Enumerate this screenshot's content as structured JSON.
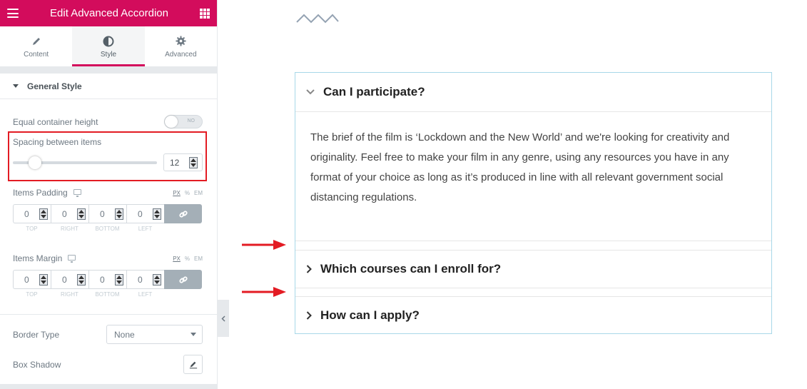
{
  "header": {
    "title": "Edit Advanced Accordion",
    "menu_icon": "hamburger-icon",
    "apps_icon": "grid-icon"
  },
  "tabs": [
    {
      "label": "Content",
      "icon": "pencil-icon",
      "active": false
    },
    {
      "label": "Style",
      "icon": "contrast-icon",
      "active": true
    },
    {
      "label": "Advanced",
      "icon": "gear-icon",
      "active": false
    }
  ],
  "section": {
    "title": "General Style"
  },
  "controls": {
    "equal_height": {
      "label": "Equal container height",
      "value": "NO"
    },
    "spacing": {
      "label": "Spacing between items",
      "value": "12",
      "slider_fraction": 0.12
    },
    "padding": {
      "label": "Items Padding",
      "units": [
        "PX",
        "%",
        "EM"
      ],
      "active_unit": "PX",
      "values": [
        "0",
        "0",
        "0",
        "0"
      ],
      "sides": [
        "TOP",
        "RIGHT",
        "BOTTOM",
        "LEFT"
      ]
    },
    "margin": {
      "label": "Items Margin",
      "units": [
        "PX",
        "%",
        "EM"
      ],
      "active_unit": "PX",
      "values": [
        "0",
        "0",
        "0",
        "0"
      ],
      "sides": [
        "TOP",
        "RIGHT",
        "BOTTOM",
        "LEFT"
      ]
    },
    "border_type": {
      "label": "Border Type",
      "value": "None"
    },
    "box_shadow": {
      "label": "Box Shadow"
    }
  },
  "colors": {
    "brand": "#d30c5c",
    "highlight": "#e31b23",
    "accordion_border": "#a8d8e8"
  },
  "accordion": {
    "items": [
      {
        "question": "Can I participate?",
        "expanded": true,
        "answer": "The brief of the film is ‘Lockdown and the New World’ and we're looking for creativity and originality. Feel free to make your film in any genre, using any resources you have in any format of your choice as long as it’s produced in line with all relevant government social distancing regulations."
      },
      {
        "question": "Which courses can I enroll for?",
        "expanded": false
      },
      {
        "question": "How can I apply?",
        "expanded": false
      }
    ]
  }
}
